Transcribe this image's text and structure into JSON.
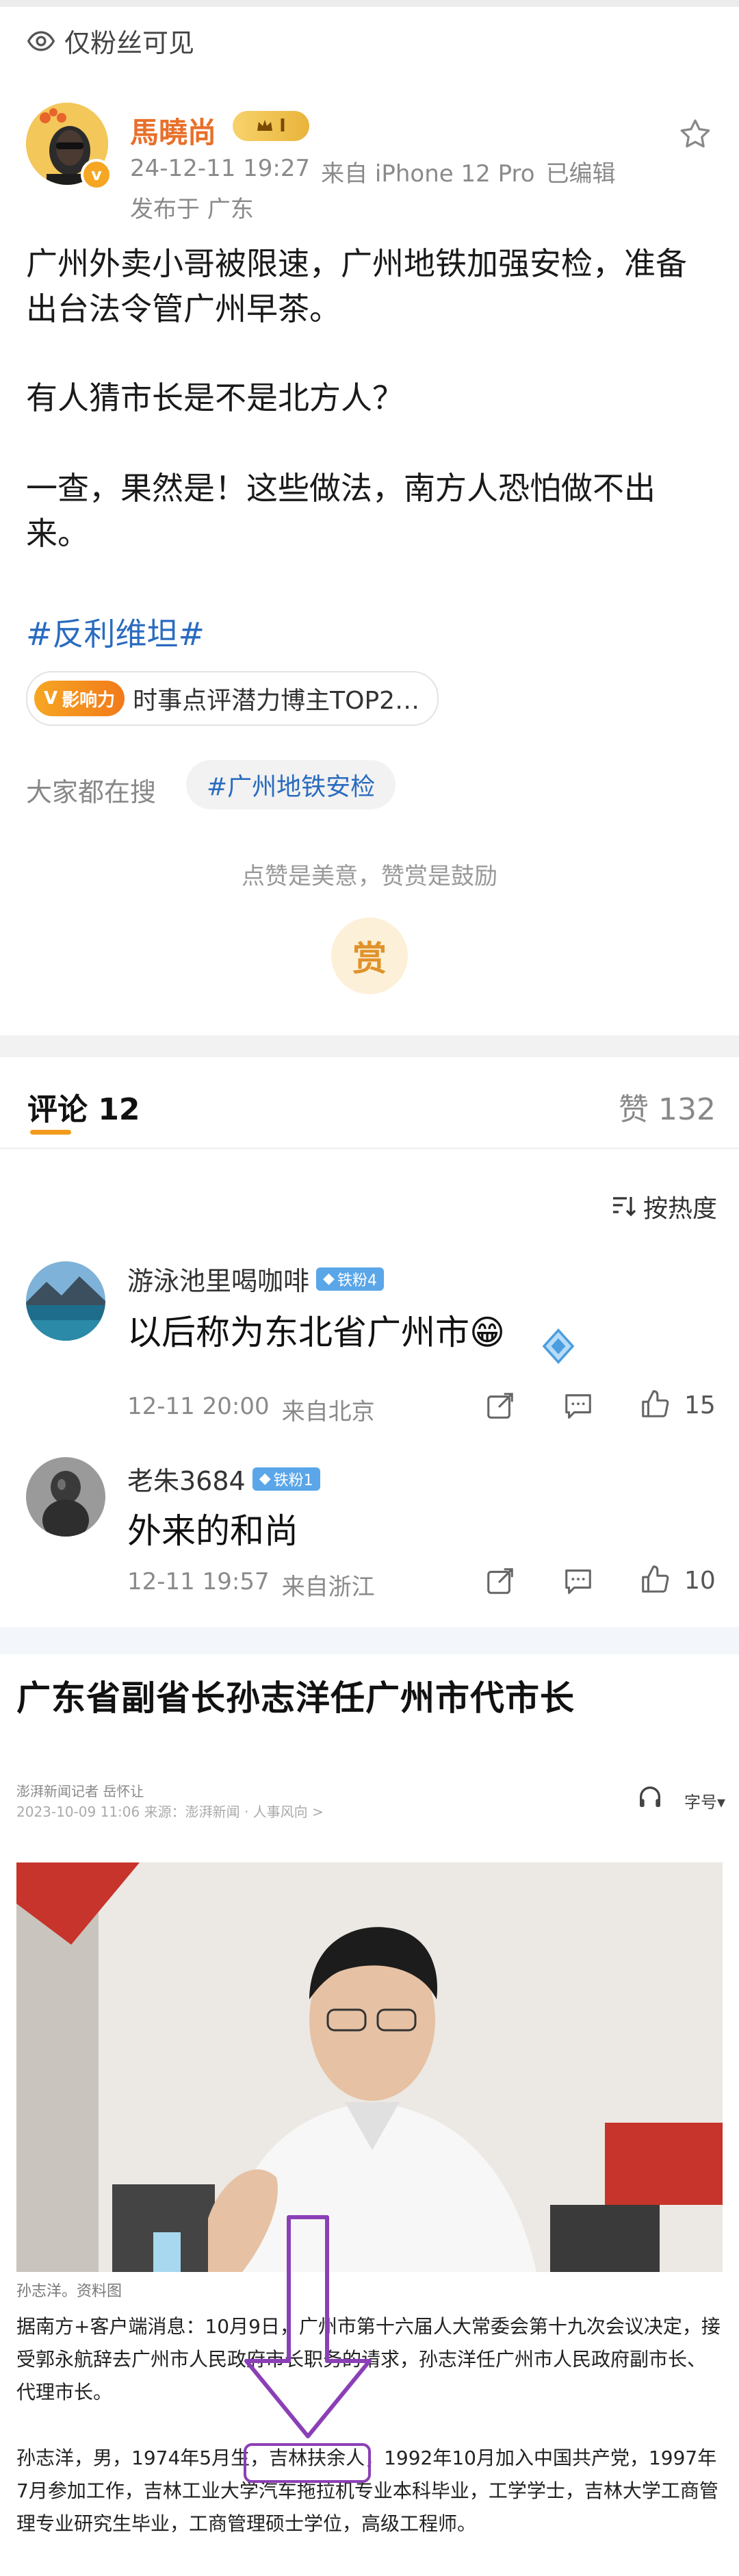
{
  "post": {
    "visibility": "仅粉丝可见",
    "author": {
      "name": "馬曉尚",
      "vip_level": "I",
      "verified": true
    },
    "meta": {
      "time": "24-12-11 19:27",
      "source": "来自 iPhone 12 Pro",
      "edited": "已编辑",
      "location": "发布于 广东"
    },
    "paragraphs": [
      "广州外卖小哥被限速，广州地铁加强安检，准备出台法令管广州早茶。",
      "有人猜市长是不是北方人？",
      "一查，果然是！这些做法，南方人恐怕做不出来。"
    ],
    "hashtag": "#反利维坦#",
    "rank_chip": {
      "logo": "影响力",
      "text": "时事点评潜力博主TOP2…"
    },
    "search": {
      "label": "大家都在搜",
      "topic": "#广州地铁安检"
    },
    "reward": {
      "hint": "点赞是美意，赞赏是鼓励",
      "button": "赏"
    }
  },
  "tabs": {
    "comments": "评论 12",
    "likes": "赞 132"
  },
  "sort": {
    "label": "按热度"
  },
  "comments": [
    {
      "name": "游泳池里喝咖啡",
      "badge": "铁粉4",
      "text": "以后称为东北省广州市😁",
      "time": "12-11 20:00",
      "location": "来自北京",
      "likes": "15"
    },
    {
      "name": "老朱3684",
      "badge": "铁粉1",
      "text": "外来的和尚",
      "time": "12-11 19:57",
      "location": "来自浙江",
      "likes": "10"
    }
  ],
  "news": {
    "title": "广东省副省长孙志洋任广州市代市长",
    "byline": "澎湃新闻记者 岳怀让",
    "date": "2023-10-09 11:06  来源：澎湃新闻 · 人事风向 >",
    "font_button": "字号▾",
    "caption": "孙志洋。资料图",
    "paragraphs": [
      "据南方+客户端消息：10月9日，广州市第十六届人大常委会第十九次会议决定，接受郭永航辞去广州市人民政府市长职务的请求，孙志洋任广州市人民政府副市长、代理市长。",
      "孙志洋，男，1974年5月生，吉林扶余人，1992年10月加入中国共产党，1997年7月参加工作，吉林工业大学汽车拖拉机专业本科毕业，工学学士，吉林大学工商管理专业研究生毕业，工商管理硕士学位，高级工程师。"
    ],
    "highlight": "吉林扶余人"
  },
  "colors": {
    "accent_orange": "#f29b1c",
    "link_blue": "#2a6bbf",
    "author_orange": "#e8702a",
    "annotation_purple": "#8b3fb6"
  },
  "icons": [
    "eye-icon",
    "star-icon",
    "sort-icon",
    "share-icon",
    "comment-icon",
    "like-icon",
    "headphone-icon"
  ]
}
